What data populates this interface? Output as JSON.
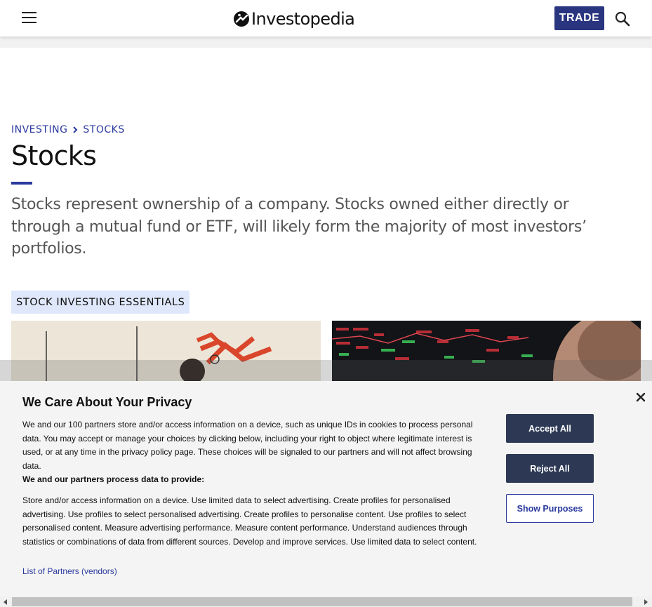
{
  "header": {
    "logo_text": "Investopedia",
    "trade_label": "TRADE",
    "icons": {
      "menu": "hamburger-menu-icon",
      "search": "search-icon",
      "logo": "investopedia-logo-icon"
    }
  },
  "breadcrumb": [
    {
      "label": "INVESTING"
    },
    {
      "label": "STOCKS"
    }
  ],
  "page": {
    "title": "Stocks",
    "intro": "Stocks represent ownership of a company. Stocks owned either directly or through a mutual fund or ETF, will likely form the majority of most investors’ portfolios.",
    "section_tag": "STOCK INVESTING ESSENTIALS"
  },
  "privacy": {
    "title": "We Care About Your Privacy",
    "paragraph1": "We and our 100 partners store and/or access information on a device, such as unique IDs in cookies to process personal data. You may accept or manage your choices by clicking below, including your right to object where legitimate interest is used, or at any time in the privacy policy page. These choices will be signaled to our partners and will not affect browsing data.",
    "paragraph2": "We and our partners process data to provide:",
    "paragraph3": "Store and/or access information on a device. Use limited data to select advertising. Create profiles for personalised advertising. Use profiles to select personalised advertising. Create profiles to personalise content. Use profiles to select personalised content. Measure advertising performance. Measure content performance. Understand audiences through statistics or combinations of data from different sources. Develop and improve services. Use limited data to select content.",
    "partners_link": "List of Partners (vendors)",
    "accept_label": "Accept All",
    "reject_label": "Reject All",
    "purposes_label": "Show Purposes"
  },
  "colors": {
    "brand_blue": "#2b3a9e",
    "trade_button": "#2a3580",
    "dialog_button": "#2c3854",
    "tag_background": "#dfe8fb"
  }
}
